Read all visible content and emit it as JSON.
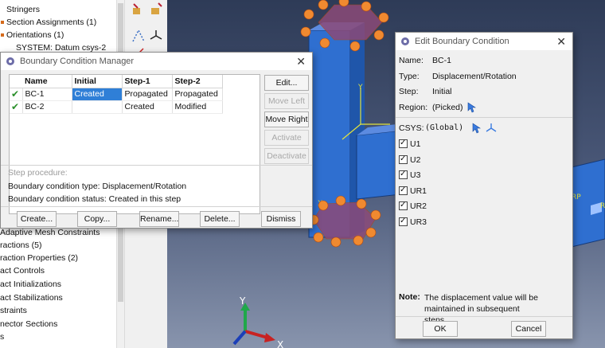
{
  "model_tree": {
    "rows": [
      "Stringers",
      "Section Assignments (1)",
      "Orientations (1)",
      "SYSTEM: Datum csys-2",
      "",
      "",
      "",
      "",
      "",
      "",
      "",
      "",
      "",
      "",
      "",
      "",
      "",
      "Adaptive Mesh Constraints",
      "ractions (5)",
      "raction Properties (2)",
      "act Controls",
      "act Initializations",
      "act Stabilizations",
      "straints",
      "nector Sections",
      "s"
    ]
  },
  "viewport": {
    "axis_y": "Y",
    "axis_x": "X",
    "label_x_small": "X",
    "label_y_small": "Y",
    "label_rp": "RP",
    "label_r": "R"
  },
  "bc_manager": {
    "title": "Boundary Condition Manager",
    "columns": [
      "Name",
      "Initial",
      "Step-1",
      "Step-2"
    ],
    "rows": [
      {
        "check": "✔",
        "name": "BC-1",
        "initial": "Created",
        "step1": "Propagated",
        "step2": "Propagated"
      },
      {
        "check": "✔",
        "name": "BC-2",
        "initial": "",
        "step1": "Created",
        "step2": "Modified"
      }
    ],
    "side_buttons": [
      "Edit...",
      "Move Left",
      "Move Right",
      "Activate",
      "Deactivate"
    ],
    "step_procedure_label": "Step procedure:",
    "bc_type": "Boundary condition type:  Displacement/Rotation",
    "bc_status": "Boundary condition status: Created in this step",
    "bottom_buttons": [
      "Create...",
      "Copy...",
      "Rename...",
      "Delete...",
      "Dismiss"
    ]
  },
  "edit_bc": {
    "title": "Edit Boundary Condition",
    "name_label": "Name:",
    "name_value": "BC-1",
    "type_label": "Type:",
    "type_value": "Displacement/Rotation",
    "step_label": "Step:",
    "step_value": "Initial",
    "region_label": "Region:",
    "region_value": "(Picked)",
    "csys_label": "CSYS:",
    "csys_value": "(Global)",
    "dofs": [
      "U1",
      "U2",
      "U3",
      "UR1",
      "UR2",
      "UR3"
    ],
    "note_label": "Note:",
    "note_text": "The displacement value will be maintained in subsequent steps.",
    "ok": "OK",
    "cancel": "Cancel"
  }
}
